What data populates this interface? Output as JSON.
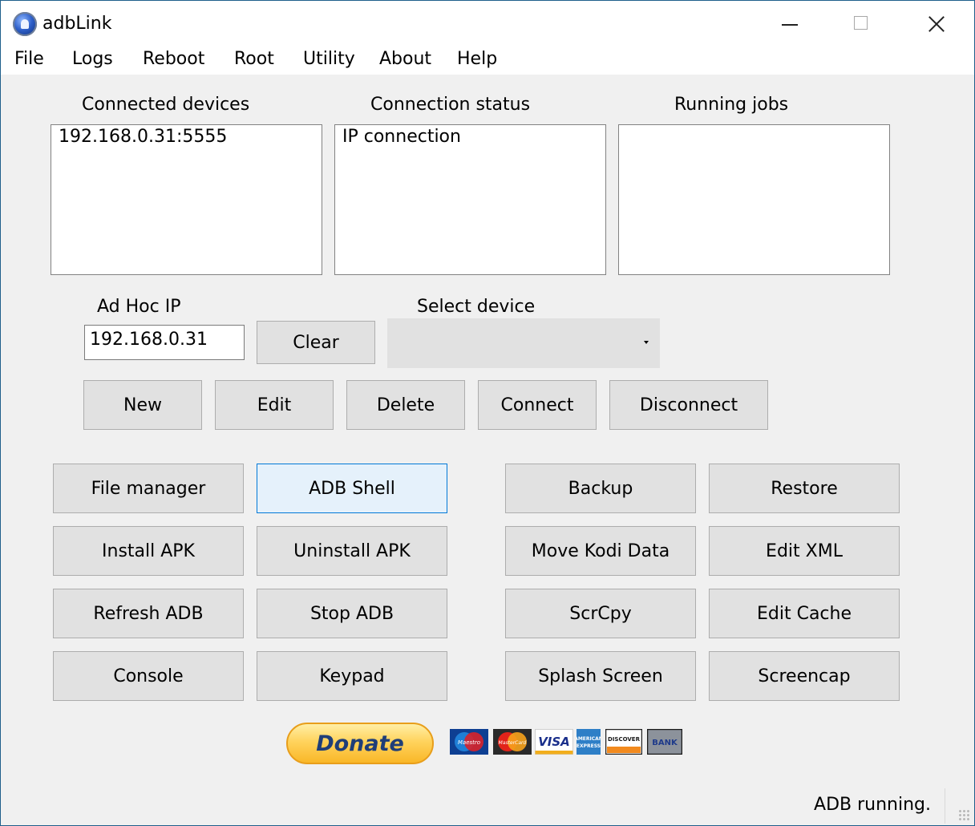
{
  "window": {
    "title": "adbLink"
  },
  "menu": [
    "File",
    "Logs",
    "Reboot",
    "Root",
    "Utility",
    "About",
    "Help"
  ],
  "panels": {
    "devices": {
      "label": "Connected devices",
      "items": [
        "192.168.0.31:5555"
      ]
    },
    "status": {
      "label": "Connection status",
      "items": [
        "IP connection"
      ]
    },
    "jobs": {
      "label": "Running jobs",
      "items": []
    }
  },
  "adhoc": {
    "label": "Ad Hoc IP",
    "value": "192.168.0.31",
    "clear_label": "Clear"
  },
  "select_device": {
    "label": "Select device",
    "value": ""
  },
  "device_buttons": [
    "New",
    "Edit",
    "Delete",
    "Connect",
    "Disconnect"
  ],
  "actions_left": [
    [
      "File manager",
      "ADB Shell"
    ],
    [
      "Install APK",
      "Uninstall APK"
    ],
    [
      "Refresh ADB",
      "Stop ADB"
    ],
    [
      "Console",
      "Keypad"
    ]
  ],
  "actions_right": [
    [
      "Backup",
      "Restore"
    ],
    [
      "Move Kodi Data",
      "Edit XML"
    ],
    [
      "ScrCpy",
      "Edit Cache"
    ],
    [
      "Splash Screen",
      "Screencap"
    ]
  ],
  "focused_action": "ADB Shell",
  "donate": {
    "label": "Donate",
    "cards": [
      {
        "icon": "maestro-card-icon",
        "text": "Maestro"
      },
      {
        "icon": "mastercard-icon",
        "text": "MasterCard"
      },
      {
        "icon": "visa-card-icon",
        "text": "VISA"
      },
      {
        "icon": "amex-card-icon",
        "text": "AMERICAN EXPRESS"
      },
      {
        "icon": "discover-card-icon",
        "text": "DISCOVER"
      },
      {
        "icon": "bank-card-icon",
        "text": "BANK"
      }
    ]
  },
  "status_bar": {
    "text": "ADB running."
  }
}
